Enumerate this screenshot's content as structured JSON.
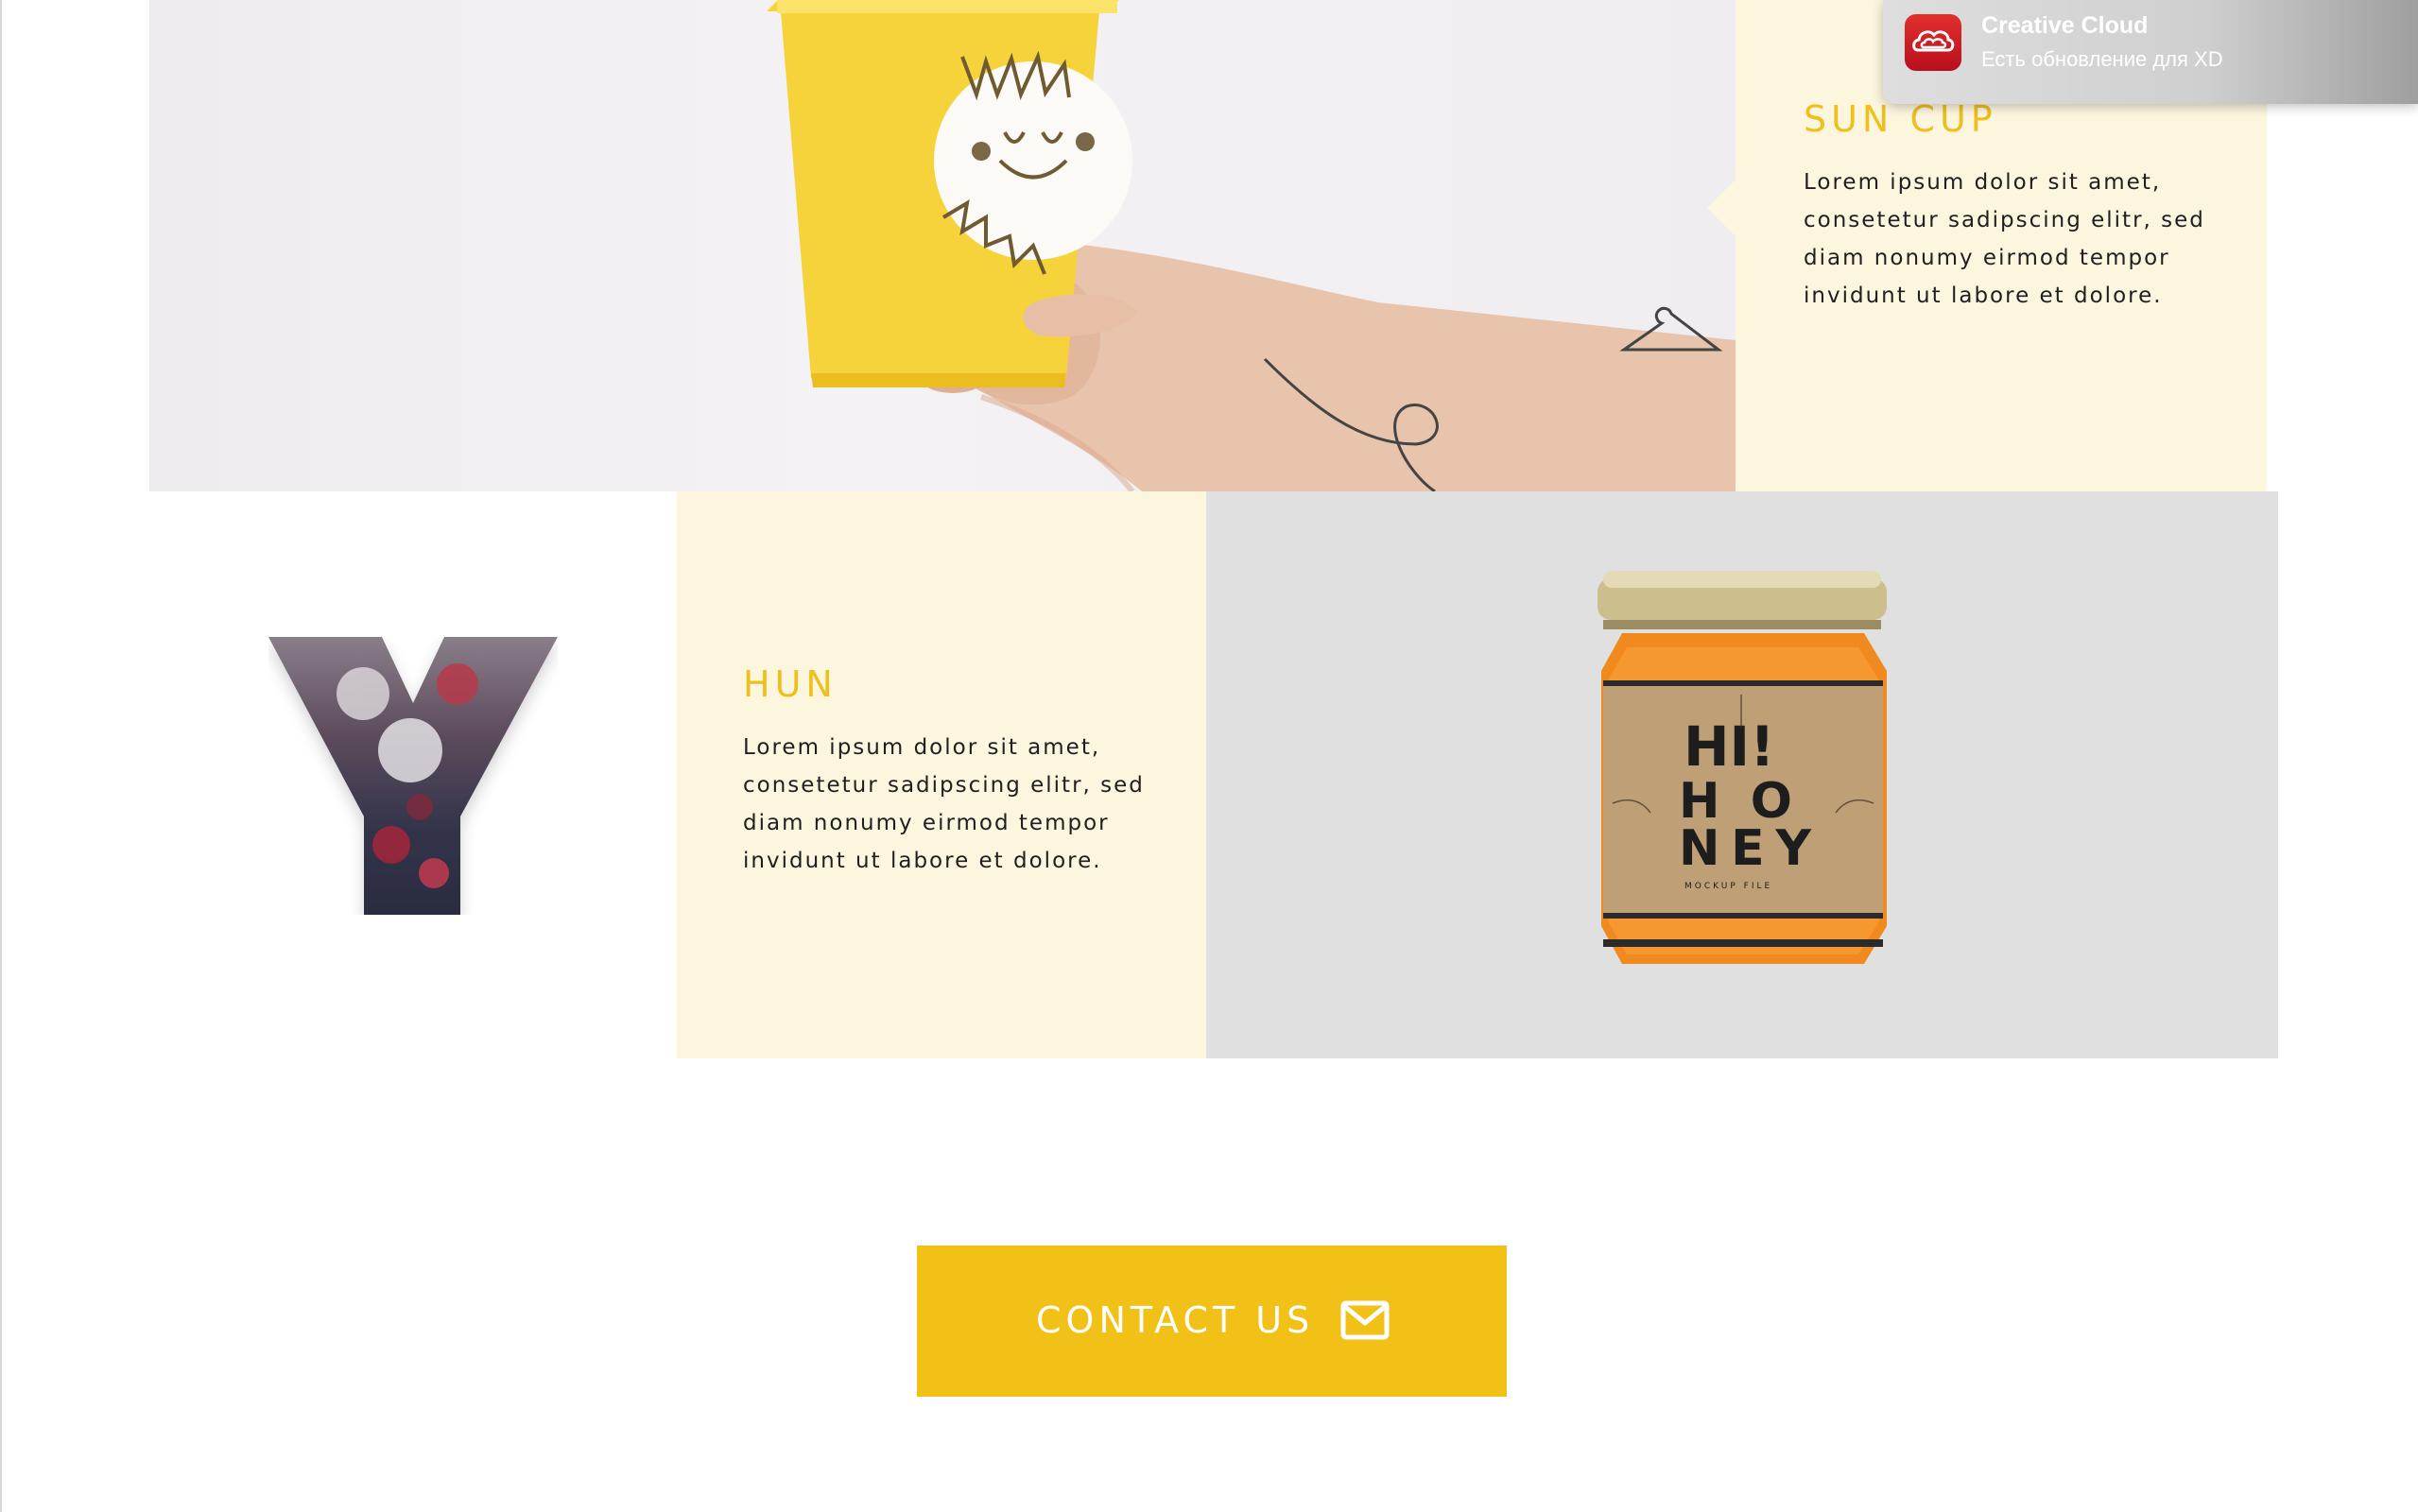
{
  "notification": {
    "app_name": "Creative Cloud",
    "message": "Есть обновление для XD",
    "icon": "creative-cloud-icon",
    "accent": "#d71f26"
  },
  "sun_cup": {
    "title": "SUN CUP",
    "text": "Lorem ipsum dolor sit amet, consetetur sadipscing elitr, sed diam nonumy eirmod tempor invidunt ut labore et dolore."
  },
  "hun": {
    "letter": "Y",
    "title": "HUN",
    "text": "Lorem ipsum dolor sit amet, consetetur sadipscing elitr, sed diam nonumy eirmod tempor invidunt ut labore et dolore."
  },
  "honey_jar": {
    "label_line1": "HI!",
    "label_line2": "HONEY",
    "label_small": "MOCKUP FILE"
  },
  "contact": {
    "label": "CONTACT US",
    "icon": "envelope-icon"
  },
  "colors": {
    "accent": "#f2c117",
    "panel": "#fcf6df",
    "title": "#efc01b"
  }
}
